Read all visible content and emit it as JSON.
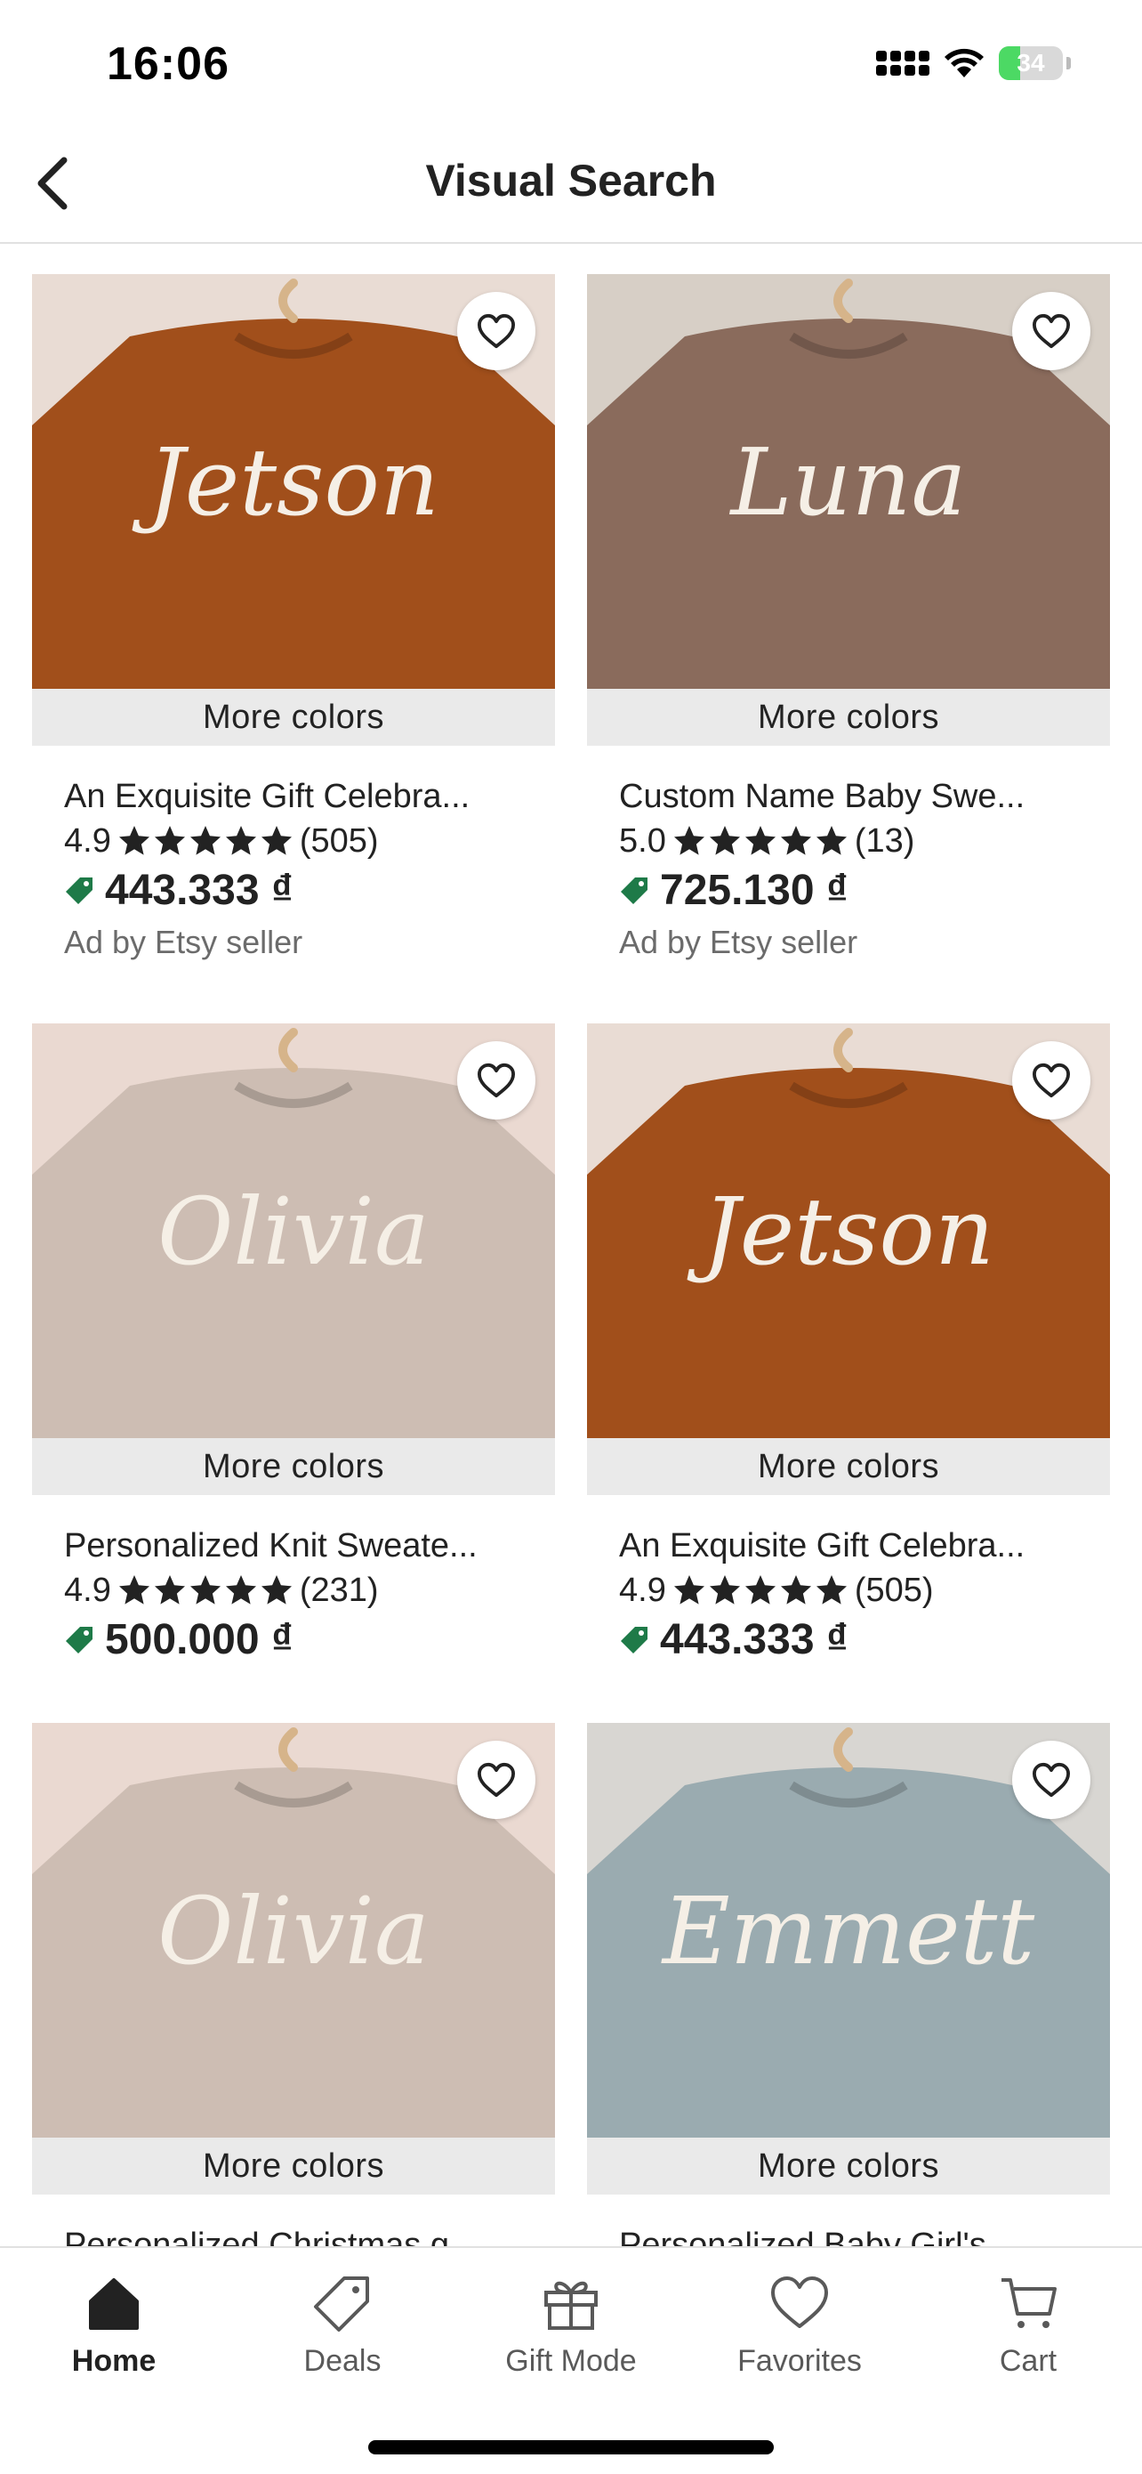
{
  "status_bar": {
    "time": "16:06",
    "battery_label": "34",
    "battery_level": 0.34
  },
  "header": {
    "title": "Visual Search",
    "back_icon": "chevron-left-icon"
  },
  "products": [
    {
      "title": "An Exquisite Gift Celebra...",
      "rating": "4.9",
      "reviews": "(505)",
      "price": "443.333 ₫",
      "ad_label": "Ad by Etsy seller",
      "more_colors": "More colors",
      "image": {
        "sweater_color": "#a14f1b",
        "bg_color": "#e9dcd4",
        "name_text": "Jetson"
      }
    },
    {
      "title": "Custom Name Baby Swe...",
      "rating": "5.0",
      "reviews": "(13)",
      "price": "725.130 ₫",
      "ad_label": "Ad by Etsy seller",
      "more_colors": "More colors",
      "image": {
        "sweater_color": "#8a6b5c",
        "bg_color": "#d7cfc6",
        "name_text": "Luna"
      }
    },
    {
      "title": "Personalized Knit Sweate...",
      "rating": "4.9",
      "reviews": "(231)",
      "price": "500.000 ₫",
      "ad_label": "",
      "more_colors": "More colors",
      "image": {
        "sweater_color": "#cdbdb3",
        "bg_color": "#ead9d1",
        "name_text": "Olivia"
      }
    },
    {
      "title": "An Exquisite Gift Celebra...",
      "rating": "4.9",
      "reviews": "(505)",
      "price": "443.333 ₫",
      "ad_label": "",
      "more_colors": "More colors",
      "image": {
        "sweater_color": "#a14f1b",
        "bg_color": "#e9dcd4",
        "name_text": "Jetson"
      }
    },
    {
      "title": "Personalized Christmas g...",
      "more_colors": "More colors",
      "image": {
        "sweater_color": "#cdbdb3",
        "bg_color": "#ead9d1",
        "name_text": "Olivia"
      }
    },
    {
      "title": "Personalized Baby Girl's...",
      "more_colors": "More colors",
      "image": {
        "sweater_color": "#9aabb0",
        "bg_color": "#d8d6d2",
        "name_text": "Emmett"
      }
    }
  ],
  "bottom_nav": [
    {
      "label": "Home",
      "icon": "home-icon",
      "active": true
    },
    {
      "label": "Deals",
      "icon": "tag-icon",
      "active": false
    },
    {
      "label": "Gift Mode",
      "icon": "gift-icon",
      "active": false
    },
    {
      "label": "Favorites",
      "icon": "heart-icon",
      "active": false
    },
    {
      "label": "Cart",
      "icon": "cart-icon",
      "active": false
    }
  ],
  "colors": {
    "price_tag": "#1e7a48",
    "star": "#222222",
    "more_colors_bg": "#eaeaea"
  }
}
